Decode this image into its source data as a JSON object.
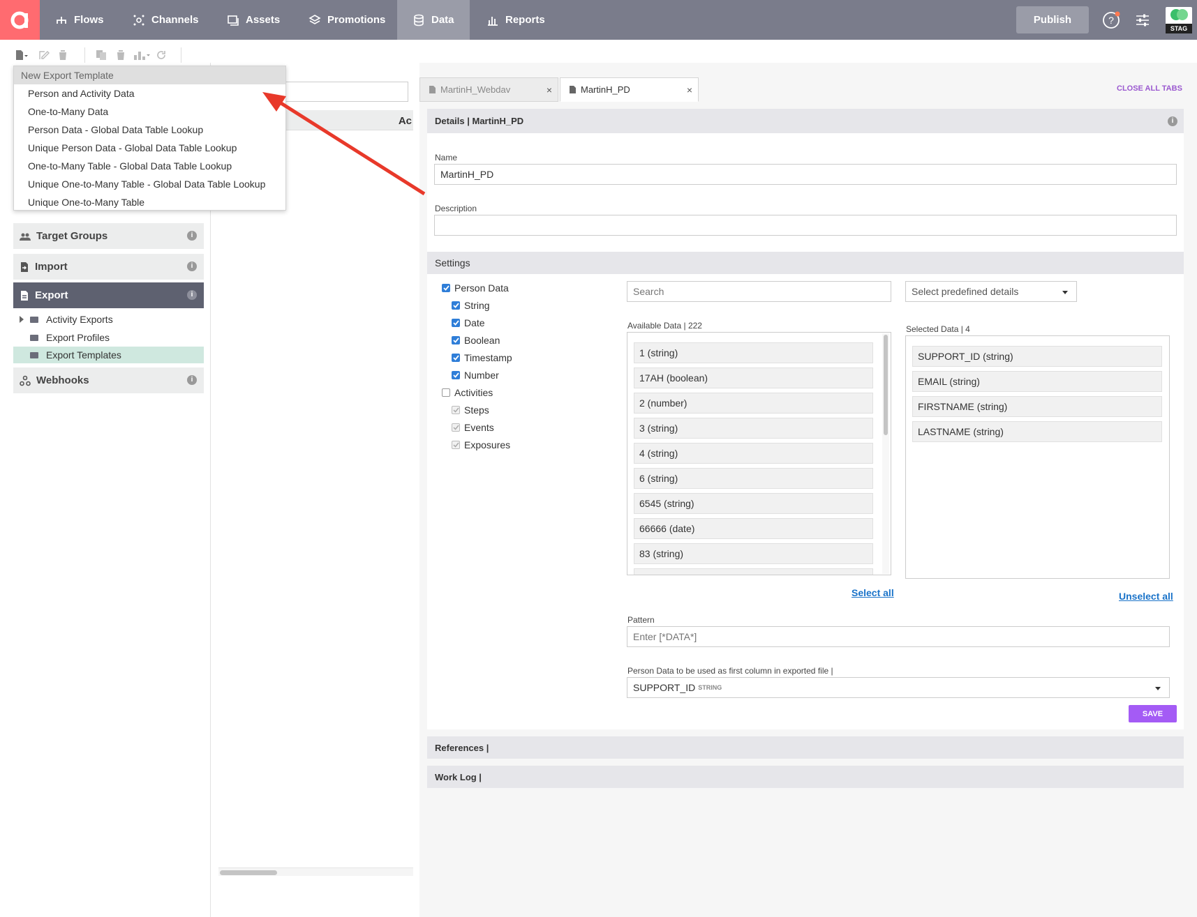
{
  "nav": {
    "items": [
      {
        "label": "Flows"
      },
      {
        "label": "Channels"
      },
      {
        "label": "Assets"
      },
      {
        "label": "Promotions"
      },
      {
        "label": "Data"
      },
      {
        "label": "Reports"
      }
    ],
    "publish_label": "Publish",
    "env_badge": "STAG"
  },
  "dropdown": {
    "header": "New Export Template",
    "options": [
      "Person and Activity Data",
      "One-to-Many Data",
      "Person Data - Global Data Table Lookup",
      "Unique Person Data - Global Data Table Lookup",
      "One-to-Many Table - Global Data Table Lookup",
      "Unique One-to-Many Table - Global Data Table Lookup",
      "Unique One-to-Many Table"
    ]
  },
  "middle": {
    "column_header_partial": "Ac"
  },
  "sidebar": {
    "sections": [
      "Target Groups",
      "Import",
      "Export",
      "Webhooks"
    ],
    "export_children": [
      "Activity Exports",
      "Export Profiles",
      "Export Templates"
    ]
  },
  "tabs": {
    "items": [
      "MartinH_Webdav",
      "MartinH_PD"
    ],
    "close_all": "CLOSE ALL TABS"
  },
  "details": {
    "header": "Details | MartinH_PD",
    "name_label": "Name",
    "name_value": "MartinH_PD",
    "description_label": "Description",
    "description_value": ""
  },
  "settings": {
    "header": "Settings",
    "checkboxes": [
      {
        "label": "Person Data",
        "state": "checked"
      },
      {
        "label": "String",
        "state": "checked"
      },
      {
        "label": "Date",
        "state": "checked"
      },
      {
        "label": "Boolean",
        "state": "checked"
      },
      {
        "label": "Timestamp",
        "state": "checked"
      },
      {
        "label": "Number",
        "state": "checked"
      },
      {
        "label": "Activities",
        "state": "unchecked"
      },
      {
        "label": "Steps",
        "state": "disabled-checked"
      },
      {
        "label": "Events",
        "state": "disabled-checked"
      },
      {
        "label": "Exposures",
        "state": "disabled-checked"
      }
    ],
    "search_placeholder": "Search",
    "predefined_placeholder": "Select predefined details",
    "available_label": "Available Data | 222",
    "available_items": [
      "1 (string)",
      "17AH (boolean)",
      "2 (number)",
      "3 (string)",
      "4 (string)",
      "6 (string)",
      "6545 (string)",
      "66666 (date)",
      "83 (string)"
    ],
    "selected_label": "Selected Data | 4",
    "selected_items": [
      "SUPPORT_ID (string)",
      "EMAIL (string)",
      "FIRSTNAME (string)",
      "LASTNAME (string)"
    ],
    "select_all": "Select all",
    "unselect_all": "Unselect all",
    "pattern_label": "Pattern",
    "pattern_placeholder": "Enter [*DATA*]",
    "first_column_label": "Person Data to be used as first column in exported file |",
    "first_column_value": "SUPPORT_ID",
    "first_column_type": "STRING",
    "save_label": "SAVE"
  },
  "references_header": "References |",
  "worklog_header": "Work Log |",
  "colors": {
    "nav_bg": "#7a7c8b",
    "logo_bg": "#ff6b70",
    "accent_purple": "#a45bf5",
    "annotation_arrow": "#e8392a"
  }
}
